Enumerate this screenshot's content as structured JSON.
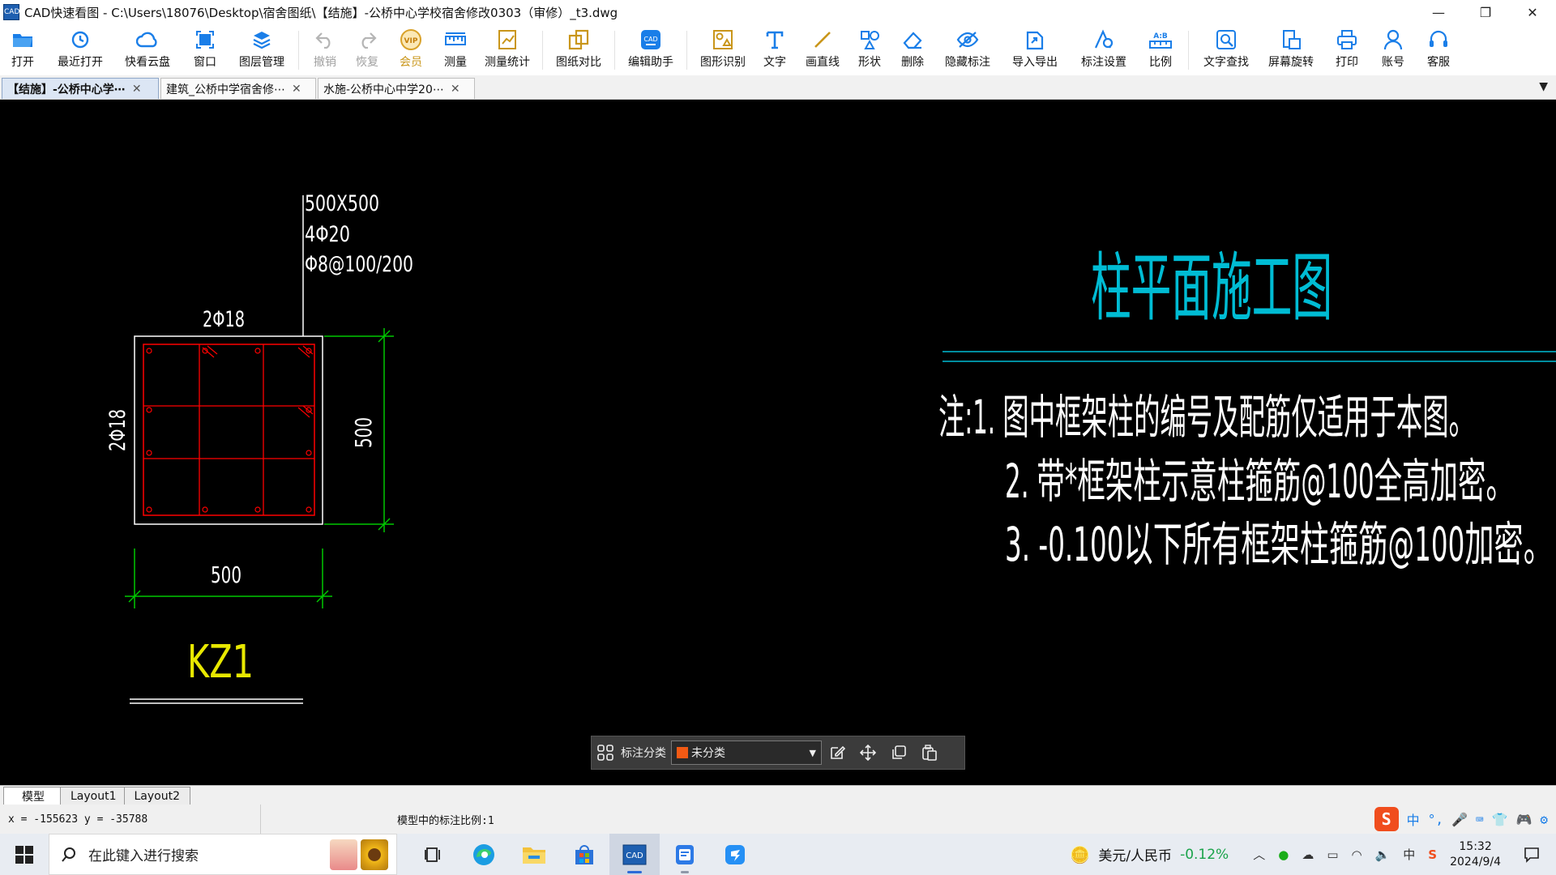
{
  "window": {
    "logo_text": "CAD",
    "title": "CAD快速看图 - C:\\Users\\18076\\Desktop\\宿舍图纸\\【结施】-公桥中心学校宿舍修改0303（审修）_t3.dwg",
    "minimize": "—",
    "restore": "❐",
    "close": "✕"
  },
  "toolbar": {
    "open": "打开",
    "recent": "最近打开",
    "cloud": "快看云盘",
    "window": "窗口",
    "layers": "图层管理",
    "undo": "撤销",
    "redo": "恢复",
    "vip": "会员",
    "measure": "测量",
    "measure_stats": "测量统计",
    "compare": "图纸对比",
    "edit_helper": "编辑助手",
    "shape_recognize": "图形识别",
    "text": "文字",
    "line": "画直线",
    "shape": "形状",
    "delete": "删除",
    "hide_annotations": "隐藏标注",
    "import_export": "导入导出",
    "annotation_settings": "标注设置",
    "scale": "比例",
    "text_search": "文字查找",
    "screen_rotate": "屏幕旋转",
    "print": "打印",
    "account": "账号",
    "support": "客服"
  },
  "doc_tabs": [
    {
      "label": "【结施】-公桥中心学⋯",
      "close": "✕"
    },
    {
      "label": "建筑_公桥中学宿舍修⋯",
      "close": "✕"
    },
    {
      "label": "水施-公桥中心中学20⋯",
      "close": "✕"
    }
  ],
  "tab_menu": "▼",
  "drawing": {
    "leader_lines": [
      "500X500",
      "4Φ20",
      "Φ8@100/200"
    ],
    "top_rebar": "2Φ18",
    "side_rebar": "2Φ18",
    "dim_height": "500",
    "dim_width": "500",
    "column_id": "KZ1",
    "plan_title": "柱平面施工图",
    "notes": [
      "注:1. 图中框架柱的编号及配筋仅适用于本图。",
      "2. 带*框架柱示意柱箍筋@100全高加密。",
      "3. -0.100以下所有框架柱箍筋@100加密。"
    ]
  },
  "annotation_bar": {
    "label": "标注分类",
    "selected": "未分类",
    "swatch_color": "#f25a14",
    "arrow": "▼"
  },
  "layout_tabs": [
    "模型",
    "Layout1",
    "Layout2"
  ],
  "status": {
    "coords": "x = -155623 y = -35788",
    "scale_text": "模型中的标注比例:1"
  },
  "ime": {
    "lang": "中",
    "punct": "°,"
  },
  "taskbar": {
    "search_placeholder": "在此键入进行搜索",
    "fx_label": "美元/人民币",
    "fx_change": "-0.12%",
    "ime_lang": "中",
    "time": "15:32",
    "date": "2024/9/4"
  },
  "colors": {
    "canvas_bg": "#000000",
    "cad_white": "#ffffff",
    "cad_red": "#ff0000",
    "cad_green": "#00c800",
    "cad_yellow": "#e8e800",
    "cad_cyan": "#00bcd4",
    "accent_blue": "#1a7ee8"
  }
}
